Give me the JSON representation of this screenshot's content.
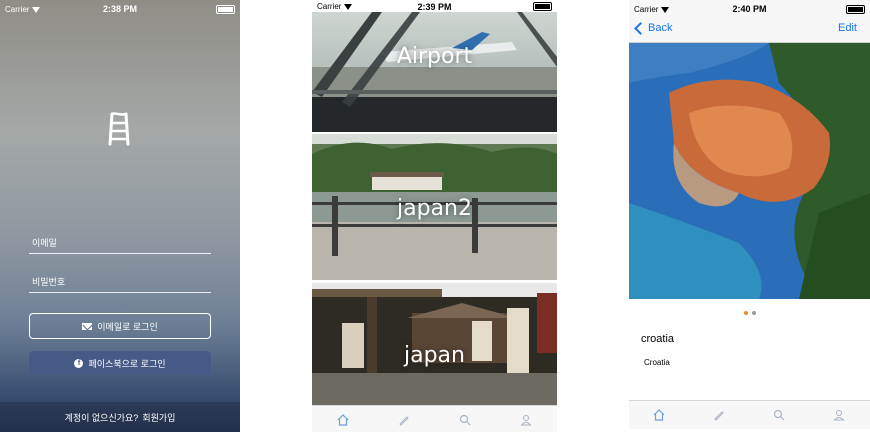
{
  "login_screen": {
    "status": {
      "carrier": "Carrier",
      "time": "2:38 PM"
    },
    "logo_icon": "ladder-icon",
    "email_label": "이메일",
    "password_label": "비밀번호",
    "email_login_label": "이메일로 로그인",
    "facebook_login_label": "페이스북으로 로그인",
    "signup_prompt": "계정이 없으신가요?",
    "signup_link": "회원가입"
  },
  "list_screen": {
    "status": {
      "carrier": "Carrier",
      "time": "2:39 PM"
    },
    "cells": [
      {
        "title": "Airport"
      },
      {
        "title": "japan2"
      },
      {
        "title": "japan"
      }
    ],
    "tabs": [
      "home-icon",
      "pencil-icon",
      "search-icon",
      "person-icon"
    ]
  },
  "detail_screen": {
    "status": {
      "carrier": "Carrier",
      "time": "2:40 PM"
    },
    "nav": {
      "back_label": "Back",
      "edit_label": "Edit"
    },
    "page_dots": {
      "count": 2,
      "active": 0,
      "active_color": "#f08a24",
      "inactive_color": "#9a9a9a"
    },
    "title": "croatia",
    "description": "Croatia",
    "tabs": [
      "home-icon",
      "pencil-icon",
      "search-icon",
      "person-icon"
    ]
  },
  "colors": {
    "ios_blue": "#1a73e8",
    "facebook_blue": "#465a86",
    "tab_inactive": "#a9b4c4",
    "tab_active": "#6fa0d8"
  }
}
